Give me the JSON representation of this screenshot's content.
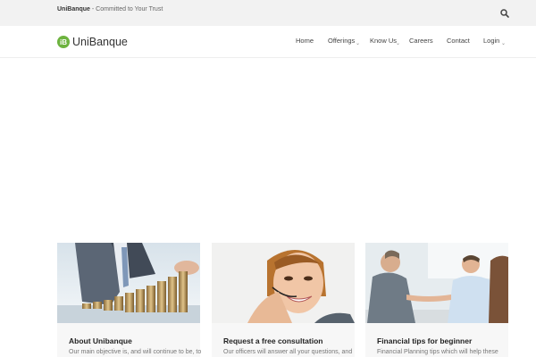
{
  "topbar": {
    "brand": "UniBanque",
    "tagline": "- Committed to Your Trust",
    "search_icon": "search-icon"
  },
  "nav": {
    "logo_mark": "iB",
    "logo_text": "UniBanque",
    "items": [
      {
        "label": "Home",
        "has_dropdown": false
      },
      {
        "label": "Offerings",
        "has_dropdown": true
      },
      {
        "label": "Know Us",
        "has_dropdown": true
      },
      {
        "label": "Careers",
        "has_dropdown": false
      },
      {
        "label": "Contact",
        "has_dropdown": false
      },
      {
        "label": "Login",
        "has_dropdown": true
      }
    ]
  },
  "cards": [
    {
      "title": "About Unibanque",
      "text": "Our main objective is, and will continue to be, to",
      "image": "coin-stacks-photo"
    },
    {
      "title": "Request a free consultation",
      "text": "Our officers will answer all your questions, and",
      "image": "support-agent-headset-photo"
    },
    {
      "title": "Financial tips for beginner",
      "text": "Financial Planning tips which will help these",
      "image": "handshake-meeting-photo"
    }
  ],
  "colors": {
    "brand_green": "#6db33f",
    "topbar_bg": "#f2f2f2",
    "card_bg": "#f7f7f7"
  }
}
